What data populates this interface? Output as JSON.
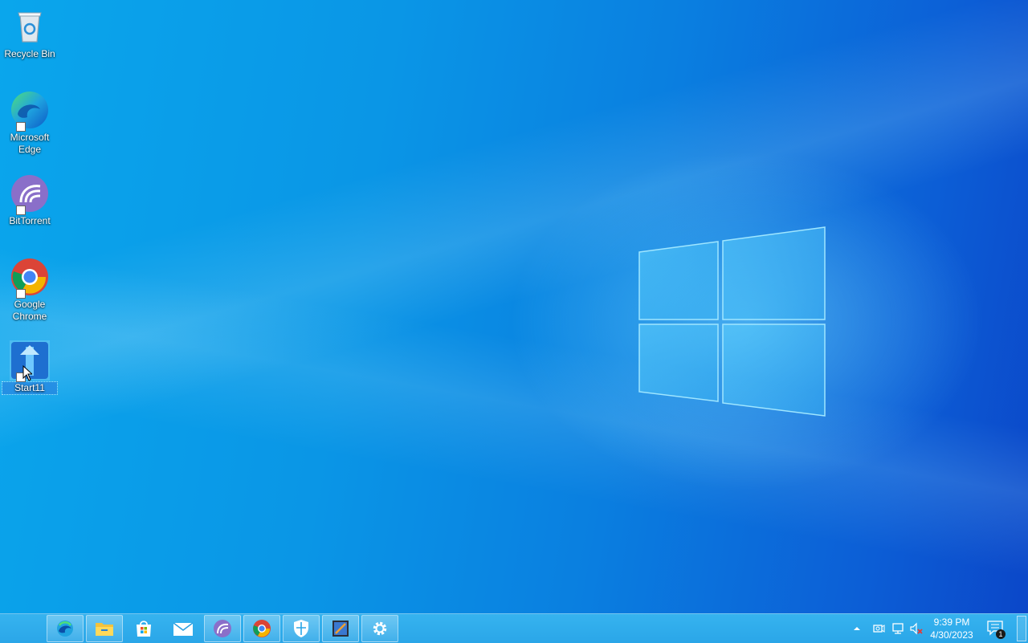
{
  "desktop": {
    "icons": [
      {
        "name": "recycle-bin",
        "label": "Recycle Bin"
      },
      {
        "name": "microsoft-edge",
        "label": "Microsoft Edge"
      },
      {
        "name": "bittorrent",
        "label": "BitTorrent"
      },
      {
        "name": "google-chrome",
        "label": "Google Chrome"
      },
      {
        "name": "start11",
        "label": "Start11"
      }
    ]
  },
  "taskbar": {
    "pinned": [
      "edge-icon",
      "file-explorer-icon",
      "microsoft-store-icon",
      "mail-icon",
      "bittorrent-icon",
      "chrome-icon",
      "windows-security-icon",
      "start11-app-icon",
      "settings-icon"
    ],
    "tray": {
      "time": "9:39 PM",
      "date": "4/30/2023",
      "notification_count": "1"
    }
  },
  "colors": {
    "wallpaper_accent": "#0a96e6",
    "taskbar": "#2aa6e8"
  }
}
